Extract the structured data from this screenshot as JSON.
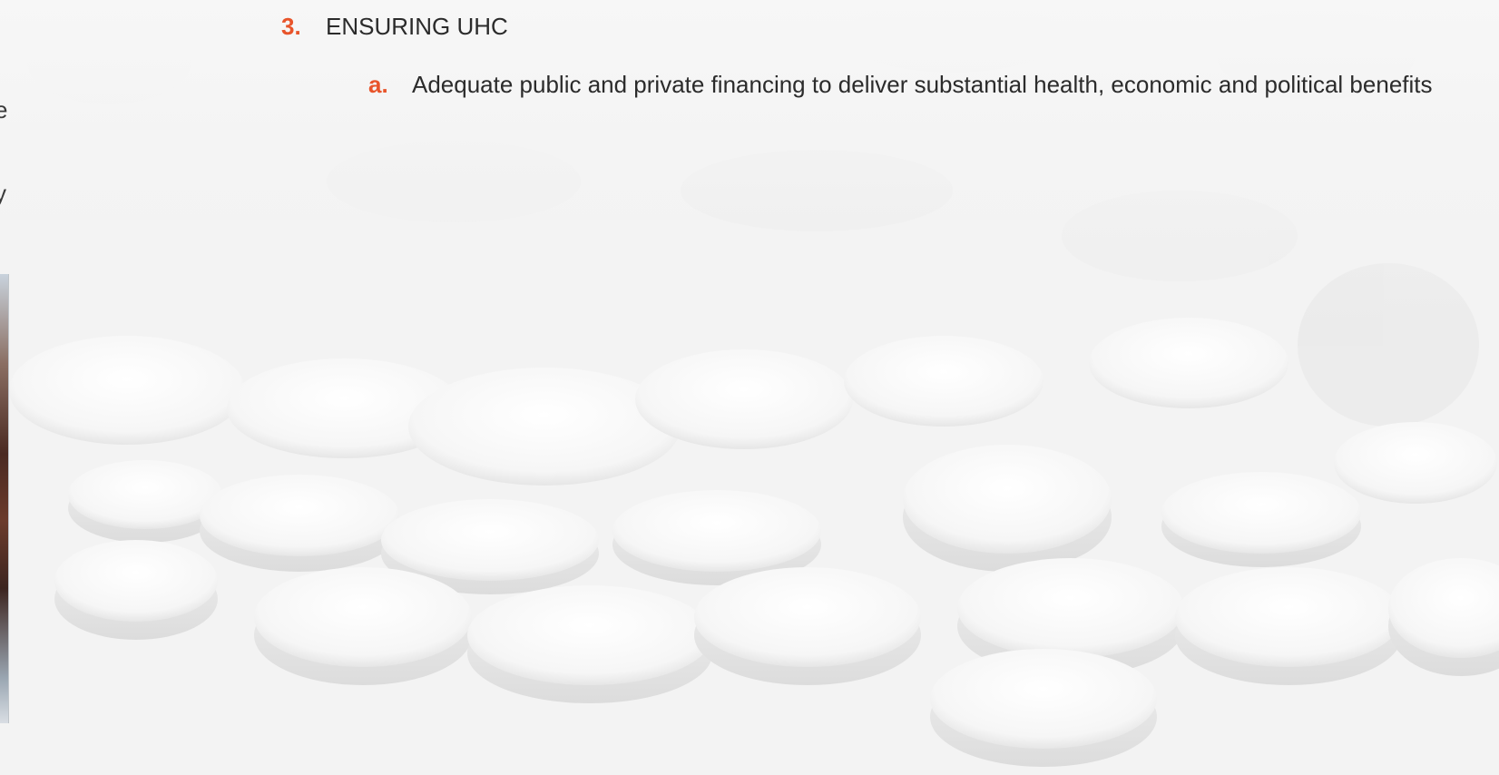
{
  "sections": [
    {
      "number": "3.",
      "title": "ENSURING UHC",
      "items": [
        {
          "letter": "a.",
          "text": "Adequate public and private financing to deliver substantial health, economic and political benefits"
        }
      ]
    }
  ],
  "left_fragments": [
    "e",
    "y"
  ],
  "colors": {
    "accent": "#e8542a",
    "text": "#2b2b2b",
    "background": "#f4f4f4"
  }
}
